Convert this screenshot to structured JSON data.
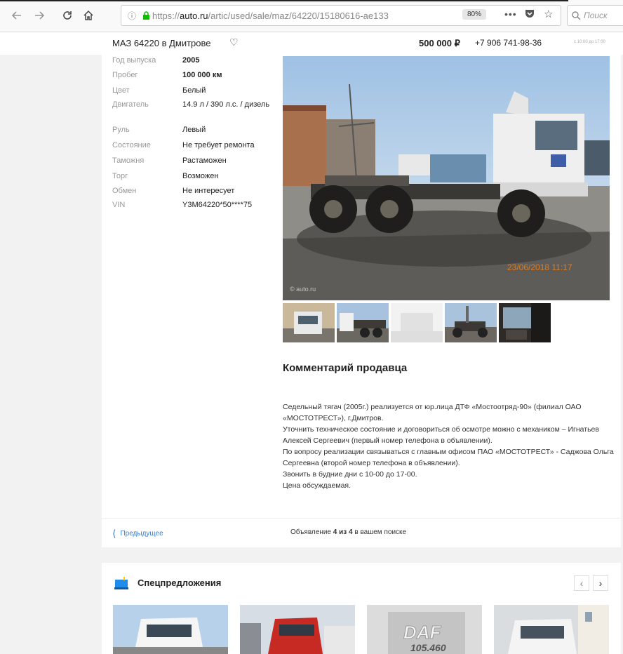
{
  "browser": {
    "url_prefix": "https://",
    "url_domain": "auto.ru",
    "url_path": "/artic/used/sale/maz/64220/15180616-ae133",
    "zoom": "80%",
    "more_label": "•••",
    "search_placeholder": "Поиск"
  },
  "header": {
    "title": "МАЗ 64220 в Дмитрове",
    "price": "500 000 ₽",
    "phone": "+7 906 741-98-36",
    "hours": "с 10:00 до 17:00"
  },
  "specs": [
    {
      "key": "Год выпуска",
      "value": "2005",
      "bold": true
    },
    {
      "key": "Пробег",
      "value": "100 000 км",
      "bold": true
    },
    {
      "key": "Цвет",
      "value": "Белый",
      "bold": false
    },
    {
      "key": "Двигатель",
      "value": "14.9 л / 390 л.с. / дизель",
      "bold": false
    },
    {
      "key": "Руль",
      "value": "Левый",
      "bold": false
    },
    {
      "key": "Состояние",
      "value": "Не требует ремонта",
      "bold": false
    },
    {
      "key": "Таможня",
      "value": "Растаможен",
      "bold": false
    },
    {
      "key": "Торг",
      "value": "Возможен",
      "bold": false
    },
    {
      "key": "Обмен",
      "value": "Не интересует",
      "bold": false
    },
    {
      "key": "VIN",
      "value": "Y3M64220*50****75",
      "bold": false
    }
  ],
  "photo": {
    "date_stamp": "23/06/2018 11:17",
    "watermark": "© auto.ru"
  },
  "comment": {
    "title": "Комментарий продавца",
    "lines": [
      "Седельный тягач (2005г.) реализуется от юр.лица ДТФ «Мостоотряд-90» (филиал ОАО «МОСТОТРЕСТ»), г.Дмитров.",
      "Уточнить техническое состояние и договориться об осмотре можно с механиком – Игнатьев Алексей Сергеевич (первый номер телефона в объявлении).",
      "По вопросу реализации связываться с главным офисом ПАО «МОСТОТРЕСТ» - Саджова Ольга Сергеевна (второй номер телефона в объявлении).",
      "Звонить в будние дни с 10-00 до 17-00.",
      "Цена обсуждаемая."
    ]
  },
  "pagination": {
    "prev_label": "Предыдущее",
    "counter_prefix": "Объявление ",
    "counter_bold": "4 из 4",
    "counter_suffix": " в вашем поиске"
  },
  "offers": {
    "title": "Спецпредложения",
    "daf_text": "DAF",
    "daf_model": "105.460",
    "accent": "#1f8ceb"
  }
}
